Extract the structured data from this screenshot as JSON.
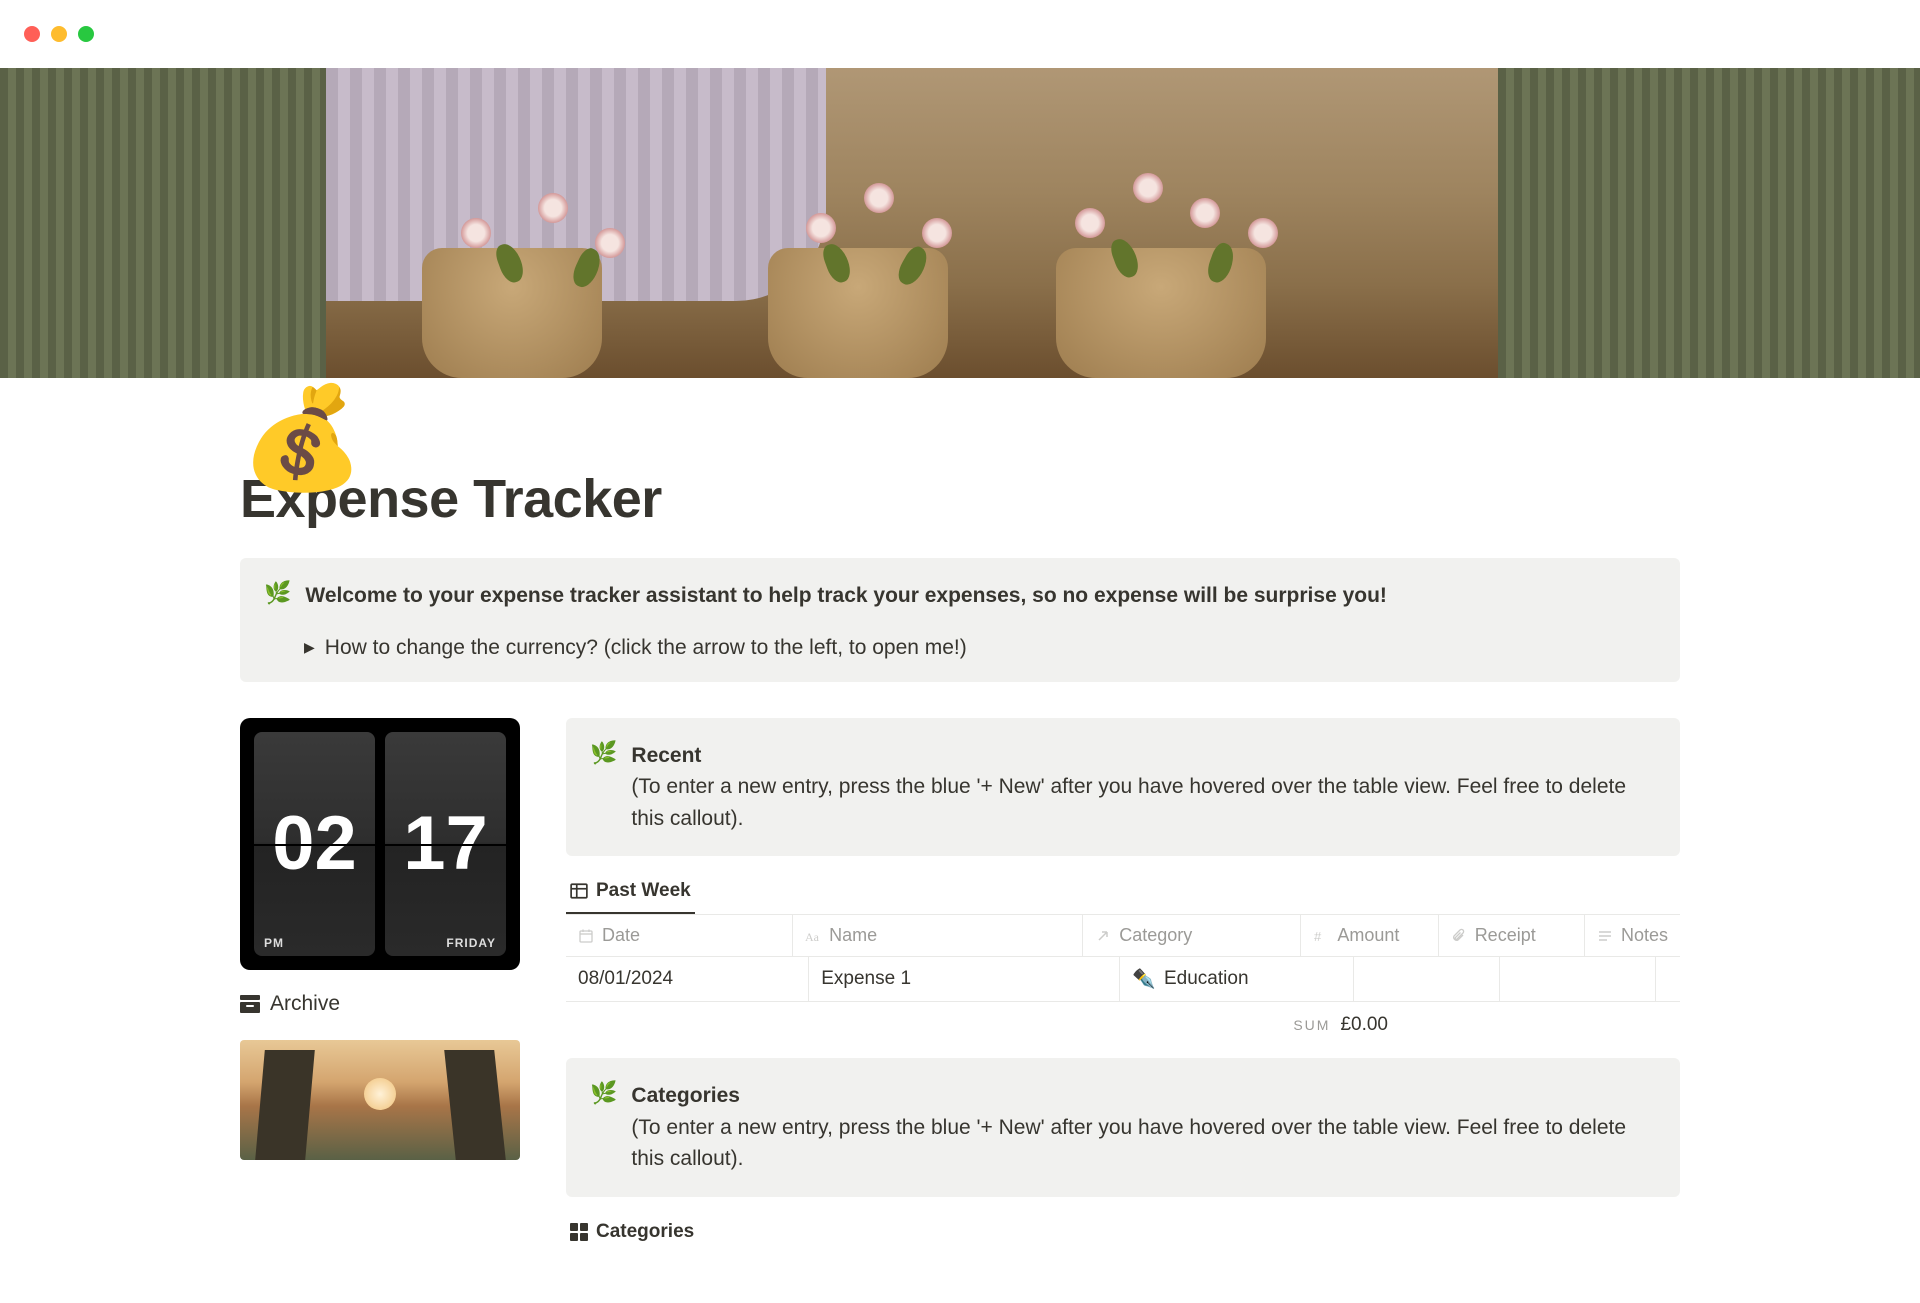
{
  "page": {
    "icon": "💰",
    "title": "Expense Tracker"
  },
  "welcome_callout": {
    "emoji": "🌿",
    "text": "Welcome to your expense tracker assistant to help track your expenses, so no expense will be surprise you!",
    "toggle_text": "How to change the currency? (click the arrow to the left, to open me!)"
  },
  "clock": {
    "hour": "02",
    "minute": "17",
    "period": "PM",
    "day": "FRIDAY"
  },
  "archive": {
    "label": "Archive"
  },
  "recent_callout": {
    "emoji": "🌿",
    "title": "Recent",
    "subtitle": "(To enter a new entry, press the blue '+ New' after you have hovered over the table view. Feel free to delete this callout)."
  },
  "recent_view": {
    "tab_label": "Past Week",
    "columns": {
      "date": "Date",
      "name": "Name",
      "category": "Category",
      "amount": "Amount",
      "receipt": "Receipt",
      "notes": "Notes"
    },
    "rows": [
      {
        "date": "08/01/2024",
        "name": "Expense 1",
        "category_icon": "✒️",
        "category": "Education",
        "amount": "",
        "receipt": "",
        "notes": ""
      }
    ],
    "sum_label": "SUM",
    "sum_value": "£0.00"
  },
  "categories_callout": {
    "emoji": "🌿",
    "title": "Categories",
    "subtitle": "(To enter a new entry, press the blue '+ New' after you have hovered over the table view. Feel free to delete this callout)."
  },
  "categories_view": {
    "tab_label": "Categories"
  }
}
